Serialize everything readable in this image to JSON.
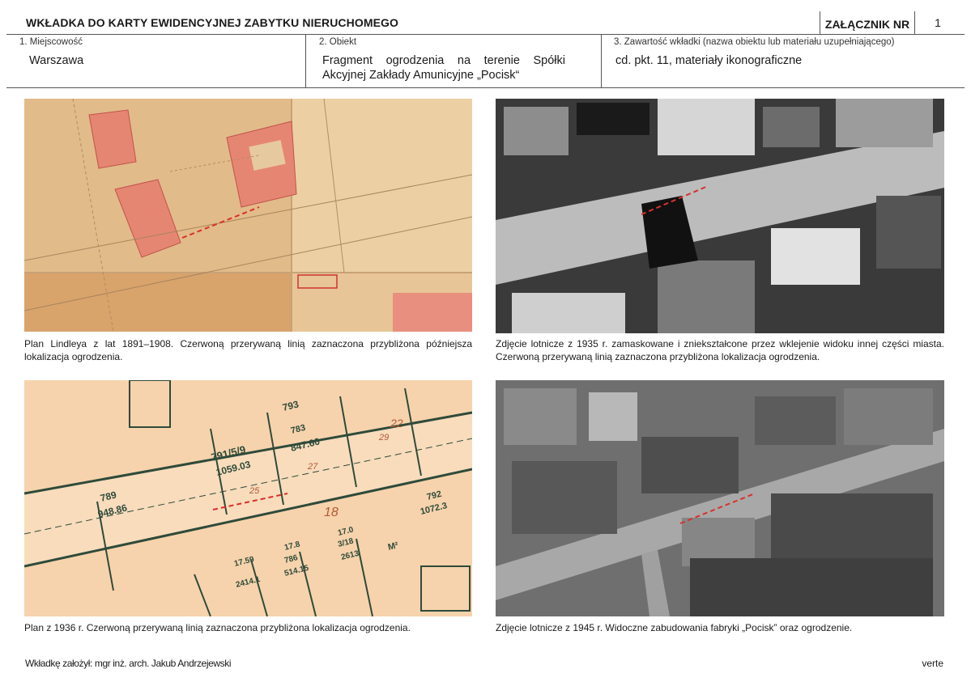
{
  "header": {
    "title": "WKŁADKA DO KARTY EWIDENCYJNEJ ZABYTKU NIERUCHOMEGO",
    "annex_label": "ZAŁĄCZNIK NR",
    "annex_number": "1"
  },
  "fields": [
    {
      "label": "1. Miejscowość",
      "value": "Warszawa"
    },
    {
      "label": "2. Obiekt",
      "value": "Fragment ogrodzenia na terenie Spółki Akcyjnej Zakłady Amunicyjne „Pocisk“"
    },
    {
      "label": "3. Zawartość wkładki (nazwa obiektu lub materiału uzupełniającego)",
      "value": "cd. pkt. 11, materiały ikonograficzne"
    }
  ],
  "figures": [
    {
      "caption": "Plan Lindleya z lat 1891–1908. Czerwoną przerywaną linią zaznaczona przybliżona późniejsza lokalizacja ogrodzenia."
    },
    {
      "caption": "Zdjęcie lotnicze z 1935 r. zamaskowane i zniekształcone przez wklejenie widoku innej części miasta. Czerwoną przerywaną linią zaznaczona przybliżona lokalizacja ogrodzenia."
    },
    {
      "caption": "Plan z 1936 r. Czerwoną przerywaną linią zaznaczona przybliżona lokalizacja ogrodzenia.",
      "map_labels": [
        "791/5/9",
        "1059.03",
        "793",
        "783",
        "847.60",
        "789",
        "948.86",
        "792",
        "1072.3",
        "17.0",
        "3/18",
        "2613",
        "17.8",
        "786",
        "514.15",
        "17.59",
        "2414.1",
        "22",
        "18",
        "25",
        "27",
        "29",
        "M²"
      ]
    },
    {
      "caption": "Zdjęcie lotnicze z 1945 r. Widoczne zabudowania fabryki „Pocisk” oraz ogrodzenie."
    }
  ],
  "footer": {
    "author": "Wkładkę założył: mgr inż. arch. Jakub Andrzejewski",
    "verte": "verte"
  },
  "colors": {
    "fence_line": "#d8312b",
    "old_map_paper": "#dfb98a",
    "plan_1936_paper": "#f6d3ac",
    "building_fill": "#e47a6d"
  }
}
